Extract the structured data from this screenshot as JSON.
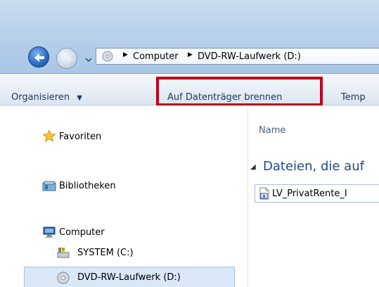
{
  "address_bar": {
    "crumbs": [
      "Computer",
      "DVD-RW-Laufwerk (D:)"
    ]
  },
  "toolbar": {
    "organize_label": "Organisieren",
    "burn_label": "Auf Datenträger brennen",
    "temp_label": "Temp"
  },
  "nav_pane": {
    "favorites": "Favoriten",
    "libraries": "Bibliotheken",
    "computer": "Computer",
    "system_drive": "SYSTEM (C:)",
    "dvd_drive": "DVD-RW-Laufwerk (D:)"
  },
  "content": {
    "column_name": "Name",
    "group_header": "Dateien, die auf",
    "file_name": "LV_PrivatRente_I"
  },
  "colors": {
    "highlight": "#c00018",
    "selection": "#d9e7f6"
  }
}
